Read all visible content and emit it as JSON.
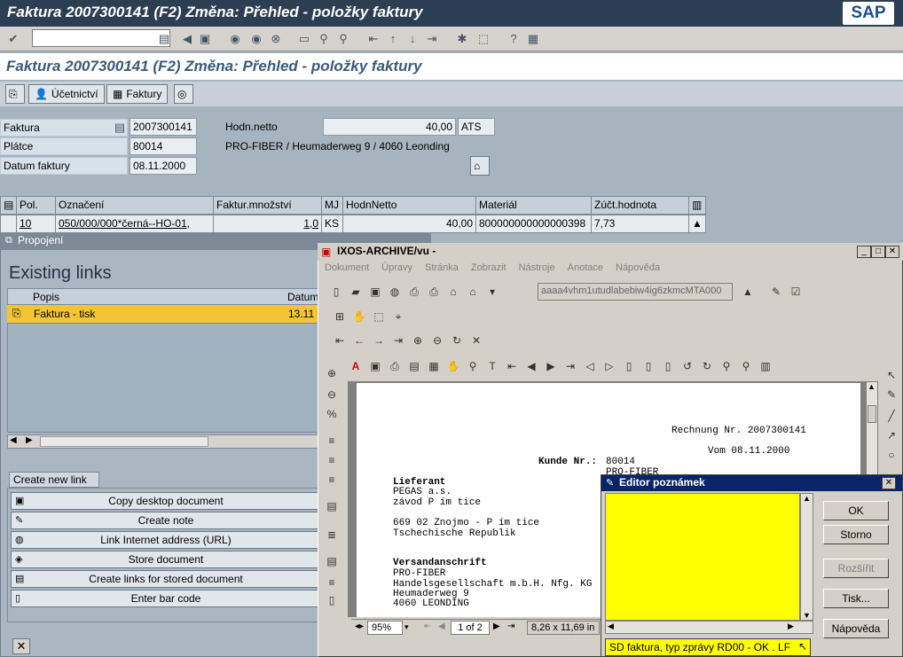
{
  "sap": {
    "window_title": "Faktura 2007300141 (F2) Změna: Přehled - položky faktury",
    "logo": "SAP",
    "page_title": "Faktura 2007300141 (F2) Změna: Přehled - položky faktury",
    "toolbar": {
      "accounting_label": "Účetnictví",
      "invoice_label": "Faktury"
    },
    "header": {
      "faktura_label": "Faktura",
      "faktura_value": "2007300141",
      "platce_label": "Plátce",
      "platce_value": "80014",
      "datum_label": "Datum faktury",
      "datum_value": "08.11.2000",
      "netto_label": "Hodn.netto",
      "netto_value": "40,00",
      "currency": "ATS",
      "address": "PRO-FIBER / Heumaderweg 9 / 4060 Leonding"
    },
    "grid": {
      "columns": [
        "Pol.",
        "Označení",
        "Faktur.množství",
        "MJ",
        "HodnNetto",
        "Materiál",
        "Zúčt.hodnota"
      ],
      "row": [
        "10",
        "050/000/000*černá--HO-01,",
        "1,0",
        "KS",
        "40,00",
        "800000000000000398",
        "7,73"
      ]
    },
    "links_panel": {
      "title": "Propojení",
      "heading": "Existing links",
      "col_popis": "Popis",
      "col_datum": "Datum",
      "item_label": "Faktura - tisk",
      "item_date": "13.11",
      "create_tab": "Create new link",
      "actions": [
        "Copy desktop document",
        "Create note",
        "Link Internet address (URL)",
        "Store document",
        "Create links for stored document",
        "Enter bar code"
      ]
    }
  },
  "ixos": {
    "title": "IXOS-ARCHIVE/vu -",
    "menu": [
      "Dokument",
      "Úpravy",
      "Stránka",
      "Zobrazit",
      "Nástroje",
      "Anotace",
      "Nápověda"
    ],
    "doc_id": "aaaa4vhm1utudlabebiw4ig6zkmcMTA000",
    "document_lines": {
      "rechnung": "Rechnung Nr. 2007300141",
      "vom": "Vom 08.11.2000",
      "kunde_label": "Kunde Nr.:",
      "kunde_value": "80014",
      "kunde_extra": "PRO-FIBER",
      "lieferant": "Lieferant",
      "pegas": "PEGAS a.s.",
      "zavod": "závod P ím tice",
      "city": "669 02 Znojmo - P ím tice",
      "country": "Tschechische Republik",
      "versand": "Versandanschrift",
      "pf": "PRO-FIBER",
      "handels": "Handelsgesellschaft m.b.H. Nfg. KG",
      "street": "Heumaderweg 9",
      "town": "4060 LEONDING"
    },
    "status": {
      "zoom": "95%",
      "page": "1 of 2",
      "size": "8,26 x 11,69 in"
    }
  },
  "notes_dialog": {
    "title": "Editor poznámek",
    "buttons": [
      "OK",
      "Storno",
      "Rozšířit",
      "Tisk...",
      "Nápověda"
    ],
    "note_type": "SD faktura, typ zprávy RD00 - OK . LF"
  }
}
